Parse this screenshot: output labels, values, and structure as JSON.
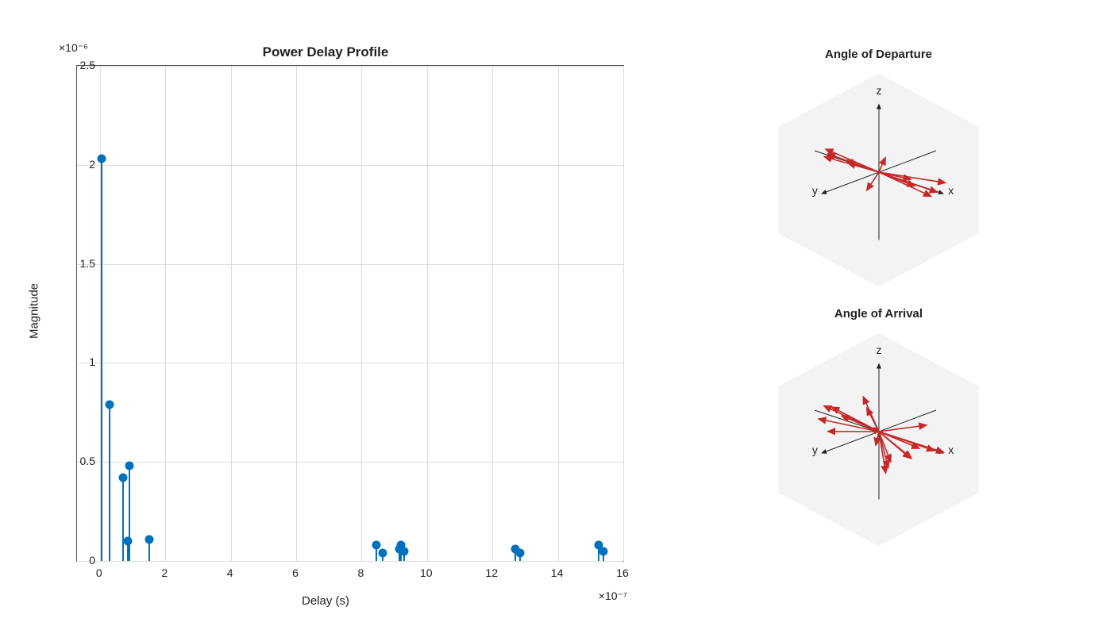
{
  "chart_data": {
    "type": "stem",
    "title": "Power Delay Profile",
    "xlabel": "Delay (s)",
    "ylabel": "Magnitude",
    "y_exponent_label": "×10⁻⁶",
    "x_exponent_label": "×10⁻⁷",
    "xlim": [
      -0.7,
      16
    ],
    "ylim": [
      0,
      2.5
    ],
    "xticks": [
      0,
      2,
      4,
      6,
      8,
      10,
      12,
      14,
      16
    ],
    "yticks": [
      0,
      0.5,
      1,
      1.5,
      2,
      2.5
    ],
    "x": [
      0.05,
      0.3,
      0.7,
      0.85,
      0.9,
      1.5,
      8.45,
      8.65,
      9.15,
      9.2,
      9.3,
      12.7,
      12.85,
      15.25,
      15.4
    ],
    "y": [
      2.03,
      0.79,
      0.42,
      0.1,
      0.48,
      0.11,
      0.08,
      0.04,
      0.06,
      0.08,
      0.05,
      0.06,
      0.04,
      0.08,
      0.05
    ],
    "marker_color": "#0072bd"
  },
  "angle_departure": {
    "title": "Angle of Departure",
    "axes": {
      "x": "x",
      "y": "y",
      "z": "z"
    },
    "vectors": [
      [
        0.95,
        0.05,
        0.02
      ],
      [
        0.9,
        -0.15,
        0.08
      ],
      [
        0.9,
        0.1,
        -0.04
      ],
      [
        0.6,
        0.05,
        0.0
      ],
      [
        0.45,
        -0.05,
        0.02
      ],
      [
        -0.85,
        0.0,
        -0.04
      ],
      [
        -0.9,
        -0.08,
        0.03
      ],
      [
        -0.75,
        0.05,
        0.05
      ],
      [
        -0.5,
        -0.02,
        -0.03
      ],
      [
        -0.45,
        0.08,
        0.06
      ],
      [
        0.3,
        0.55,
        0.0
      ],
      [
        -0.3,
        -0.45,
        -0.02
      ]
    ]
  },
  "angle_arrival": {
    "title": "Angle of Arrival",
    "axes": {
      "x": "x",
      "y": "y",
      "z": "z"
    },
    "vectors": [
      [
        0.95,
        0.1,
        0.05
      ],
      [
        0.9,
        -0.12,
        -0.06
      ],
      [
        0.85,
        0.25,
        0.1
      ],
      [
        0.55,
        0.05,
        -0.2
      ],
      [
        0.4,
        -0.1,
        -0.3
      ],
      [
        0.35,
        0.45,
        0.05
      ],
      [
        -0.9,
        -0.05,
        0.08
      ],
      [
        -0.85,
        0.1,
        -0.05
      ],
      [
        -0.8,
        -0.25,
        -0.1
      ],
      [
        -0.6,
        0.15,
        0.22
      ],
      [
        -0.45,
        -0.35,
        -0.2
      ],
      [
        -0.35,
        0.5,
        0.05
      ],
      [
        0.15,
        0.05,
        -0.55
      ],
      [
        0.05,
        -0.15,
        -0.48
      ],
      [
        -0.1,
        0.1,
        0.35
      ],
      [
        0.25,
        -0.55,
        0.0
      ],
      [
        -0.6,
        -0.4,
        0.2
      ],
      [
        0.5,
        0.4,
        -0.25
      ]
    ]
  },
  "colors": {
    "vector": "#c62828",
    "axis": "#222222",
    "hexbg": "#f3f3f3"
  }
}
